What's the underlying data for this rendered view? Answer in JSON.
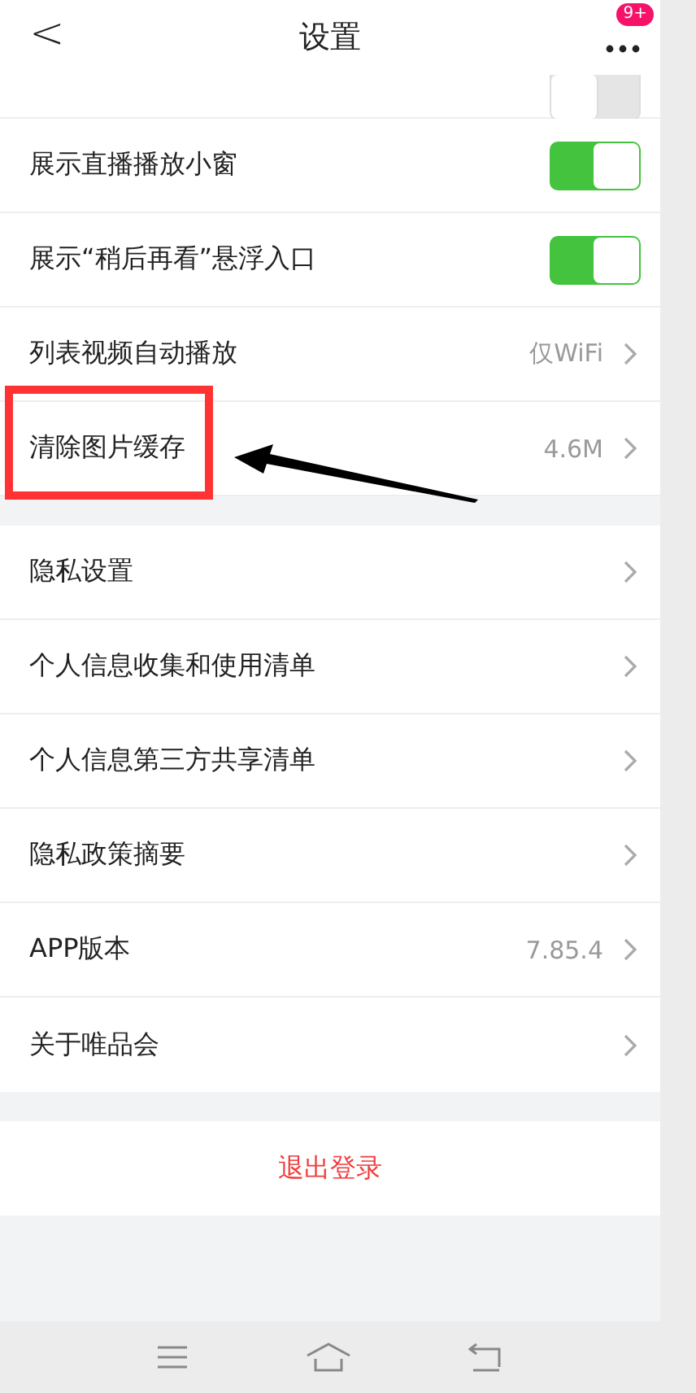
{
  "header": {
    "back": "<",
    "title": "设置",
    "badge": "9+"
  },
  "sections": [
    {
      "rows": [
        {
          "kind": "toggle",
          "partial": true,
          "on": false
        },
        {
          "kind": "toggle",
          "label": "展示直播播放小窗",
          "on": true
        },
        {
          "kind": "toggle",
          "label": "展示“稍后再看”悬浮入口",
          "on": true
        },
        {
          "kind": "link",
          "label": "列表视频自动播放",
          "value": "仅WiFi"
        },
        {
          "kind": "link",
          "label": "清除图片缓存",
          "value": "4.6M",
          "highlighted": true
        }
      ]
    },
    {
      "rows": [
        {
          "kind": "link",
          "label": "隐私设置"
        },
        {
          "kind": "link",
          "label": "个人信息收集和使用清单"
        },
        {
          "kind": "link",
          "label": "个人信息第三方共享清单"
        },
        {
          "kind": "link",
          "label": "隐私政策摘要"
        },
        {
          "kind": "link",
          "label": "APP版本",
          "value": "7.85.4"
        },
        {
          "kind": "link",
          "label": "关于唯品会"
        }
      ]
    }
  ],
  "logout": "退出登录"
}
